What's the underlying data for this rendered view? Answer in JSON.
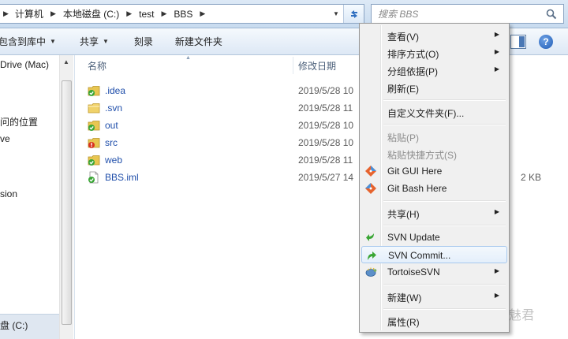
{
  "address_bar": {
    "crumbs": [
      "计算机",
      "本地磁盘 (C:)",
      "test",
      "BBS"
    ],
    "search_placeholder": "搜索 BBS"
  },
  "toolbar": {
    "include_library": "包含到库中",
    "share": "共享",
    "burn": "刻录",
    "new_folder": "新建文件夹",
    "help": "?"
  },
  "nav": {
    "items": [
      "Drive (Mac)",
      "问的位置",
      "ve",
      "sion",
      "盘 (C:)"
    ]
  },
  "columns": {
    "name": "名称",
    "modified": "修改日期"
  },
  "files": [
    {
      "name": ".idea",
      "date": "2019/5/28 10",
      "size": "",
      "icon": "folder-svn-normal-icon"
    },
    {
      "name": ".svn",
      "date": "2019/5/28 11",
      "size": "",
      "icon": "folder-icon"
    },
    {
      "name": "out",
      "date": "2019/5/28 10",
      "size": "",
      "icon": "folder-svn-normal-icon"
    },
    {
      "name": "src",
      "date": "2019/5/28 10",
      "size": "",
      "icon": "folder-svn-modified-icon"
    },
    {
      "name": "web",
      "date": "2019/5/28 11",
      "size": "",
      "icon": "folder-svn-normal-icon"
    },
    {
      "name": "BBS.iml",
      "date": "2019/5/27 14",
      "size": "2 KB",
      "icon": "file-svn-normal-icon"
    }
  ],
  "context_menu": {
    "view": "查看(V)",
    "sort": "排序方式(O)",
    "group": "分组依据(P)",
    "refresh": "刷新(E)",
    "customize": "自定义文件夹(F)...",
    "paste": "粘贴(P)",
    "paste_shortcut": "粘贴快捷方式(S)",
    "git_gui": "Git GUI Here",
    "git_bash": "Git Bash Here",
    "share": "共享(H)",
    "svn_update": "SVN Update",
    "svn_commit": "SVN Commit...",
    "tortoise": "TortoiseSVN",
    "new": "新建(W)",
    "properties": "属性(R)"
  },
  "watermark": "知乎 @魅君",
  "colors": {
    "accent": "#1f4eaa",
    "svn_ok": "#3aa635",
    "svn_modified": "#d8331f",
    "menu_bg": "#f0f0f0",
    "hover_border": "#a8c9ee"
  }
}
